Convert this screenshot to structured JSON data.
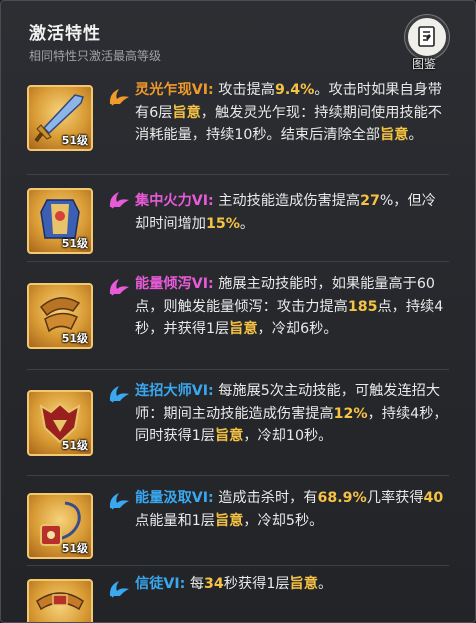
{
  "header": {
    "title": "激活特性",
    "subtitle": "相同特性只激活最高等级",
    "atlas_label": "图鉴"
  },
  "colors": {
    "name_orange": "#f09a2a",
    "name_magenta": "#e85ad8",
    "name_blue": "#39a8f0",
    "highlight": "#f5c243",
    "text": "#e9e9e9"
  },
  "traits": [
    {
      "icon": "sword-icon",
      "level": "51级",
      "name": "灵光乍现VI:",
      "segments": [
        {
          "t": " 攻击提高"
        },
        {
          "t": "9.4%",
          "hl": true
        },
        {
          "t": "。攻击时如果自身带有6层"
        },
        {
          "t": "旨意",
          "hl": true
        },
        {
          "t": "，触发灵光乍现：持续期间使用技能不消耗能量，持续10秒。结束后清除全部"
        },
        {
          "t": "旨意",
          "hl": true
        },
        {
          "t": "。"
        }
      ]
    },
    {
      "icon": "armor-icon",
      "level": "51级",
      "name": "集中火力VI:",
      "segments": [
        {
          "t": " 主动技能造成伤害提高"
        },
        {
          "t": "27",
          "hl": true
        },
        {
          "t": "%，但冷却时间增加"
        },
        {
          "t": "15%",
          "hl": true
        },
        {
          "t": "。"
        }
      ]
    },
    {
      "icon": "pauldron-icon",
      "level": "51级",
      "name": "能量倾泻VI:",
      "segments": [
        {
          "t": " 施展主动技能时，如果能量高于60点，则触发能量倾泻：攻击力提高"
        },
        {
          "t": "185",
          "hl": true
        },
        {
          "t": "点，持续4秒，并获得1层"
        },
        {
          "t": "旨意",
          "hl": true
        },
        {
          "t": "，冷却6秒。"
        }
      ]
    },
    {
      "icon": "helmet-icon",
      "level": "51级",
      "name": "连招大师VI:",
      "segments": [
        {
          "t": " 每施展5次主动技能，可触发连招大师：期间主动技能造成伤害提高"
        },
        {
          "t": "12%",
          "hl": true
        },
        {
          "t": "，持续4秒，同时获得1层"
        },
        {
          "t": "旨意",
          "hl": true
        },
        {
          "t": "，冷却10秒。"
        }
      ]
    },
    {
      "icon": "amulet-icon",
      "level": "51级",
      "name": "能量汲取VI:",
      "segments": [
        {
          "t": " 造成击杀时，有"
        },
        {
          "t": "68.9%",
          "hl": true
        },
        {
          "t": "几率获得"
        },
        {
          "t": "40",
          "hl": true
        },
        {
          "t": "点能量和1层"
        },
        {
          "t": "旨意",
          "hl": true
        },
        {
          "t": "，冷却5秒。"
        }
      ]
    },
    {
      "icon": "belt-icon",
      "level": "",
      "name": "信徒VI:",
      "segments": [
        {
          "t": " 每"
        },
        {
          "t": "34",
          "hl": true
        },
        {
          "t": "秒获得1层"
        },
        {
          "t": "旨意",
          "hl": true
        },
        {
          "t": "。"
        }
      ]
    }
  ]
}
